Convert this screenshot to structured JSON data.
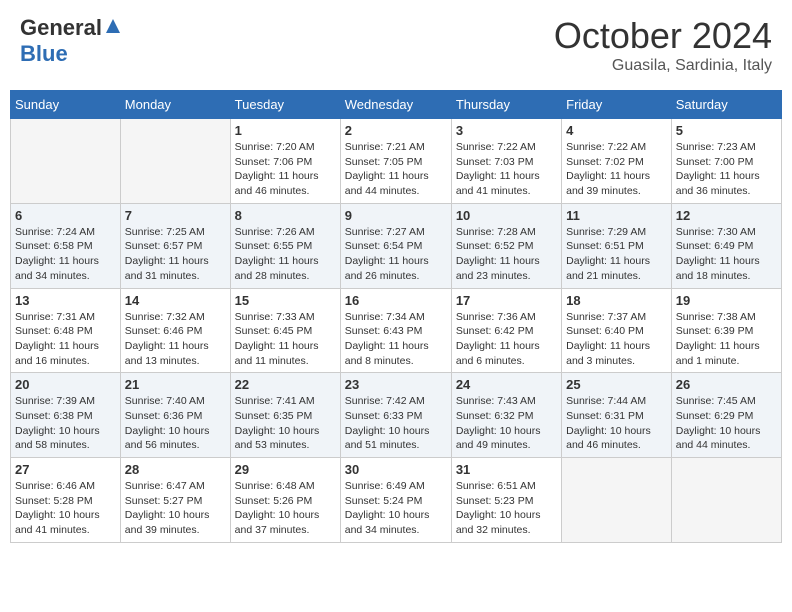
{
  "header": {
    "logo_general": "General",
    "logo_blue": "Blue",
    "month_title": "October 2024",
    "location": "Guasila, Sardinia, Italy"
  },
  "days_of_week": [
    "Sunday",
    "Monday",
    "Tuesday",
    "Wednesday",
    "Thursday",
    "Friday",
    "Saturday"
  ],
  "weeks": [
    [
      {
        "day": "",
        "empty": true
      },
      {
        "day": "",
        "empty": true
      },
      {
        "day": "1",
        "sunrise": "7:20 AM",
        "sunset": "7:06 PM",
        "daylight": "11 hours and 46 minutes."
      },
      {
        "day": "2",
        "sunrise": "7:21 AM",
        "sunset": "7:05 PM",
        "daylight": "11 hours and 44 minutes."
      },
      {
        "day": "3",
        "sunrise": "7:22 AM",
        "sunset": "7:03 PM",
        "daylight": "11 hours and 41 minutes."
      },
      {
        "day": "4",
        "sunrise": "7:22 AM",
        "sunset": "7:02 PM",
        "daylight": "11 hours and 39 minutes."
      },
      {
        "day": "5",
        "sunrise": "7:23 AM",
        "sunset": "7:00 PM",
        "daylight": "11 hours and 36 minutes."
      }
    ],
    [
      {
        "day": "6",
        "sunrise": "7:24 AM",
        "sunset": "6:58 PM",
        "daylight": "11 hours and 34 minutes."
      },
      {
        "day": "7",
        "sunrise": "7:25 AM",
        "sunset": "6:57 PM",
        "daylight": "11 hours and 31 minutes."
      },
      {
        "day": "8",
        "sunrise": "7:26 AM",
        "sunset": "6:55 PM",
        "daylight": "11 hours and 28 minutes."
      },
      {
        "day": "9",
        "sunrise": "7:27 AM",
        "sunset": "6:54 PM",
        "daylight": "11 hours and 26 minutes."
      },
      {
        "day": "10",
        "sunrise": "7:28 AM",
        "sunset": "6:52 PM",
        "daylight": "11 hours and 23 minutes."
      },
      {
        "day": "11",
        "sunrise": "7:29 AM",
        "sunset": "6:51 PM",
        "daylight": "11 hours and 21 minutes."
      },
      {
        "day": "12",
        "sunrise": "7:30 AM",
        "sunset": "6:49 PM",
        "daylight": "11 hours and 18 minutes."
      }
    ],
    [
      {
        "day": "13",
        "sunrise": "7:31 AM",
        "sunset": "6:48 PM",
        "daylight": "11 hours and 16 minutes."
      },
      {
        "day": "14",
        "sunrise": "7:32 AM",
        "sunset": "6:46 PM",
        "daylight": "11 hours and 13 minutes."
      },
      {
        "day": "15",
        "sunrise": "7:33 AM",
        "sunset": "6:45 PM",
        "daylight": "11 hours and 11 minutes."
      },
      {
        "day": "16",
        "sunrise": "7:34 AM",
        "sunset": "6:43 PM",
        "daylight": "11 hours and 8 minutes."
      },
      {
        "day": "17",
        "sunrise": "7:36 AM",
        "sunset": "6:42 PM",
        "daylight": "11 hours and 6 minutes."
      },
      {
        "day": "18",
        "sunrise": "7:37 AM",
        "sunset": "6:40 PM",
        "daylight": "11 hours and 3 minutes."
      },
      {
        "day": "19",
        "sunrise": "7:38 AM",
        "sunset": "6:39 PM",
        "daylight": "11 hours and 1 minute."
      }
    ],
    [
      {
        "day": "20",
        "sunrise": "7:39 AM",
        "sunset": "6:38 PM",
        "daylight": "10 hours and 58 minutes."
      },
      {
        "day": "21",
        "sunrise": "7:40 AM",
        "sunset": "6:36 PM",
        "daylight": "10 hours and 56 minutes."
      },
      {
        "day": "22",
        "sunrise": "7:41 AM",
        "sunset": "6:35 PM",
        "daylight": "10 hours and 53 minutes."
      },
      {
        "day": "23",
        "sunrise": "7:42 AM",
        "sunset": "6:33 PM",
        "daylight": "10 hours and 51 minutes."
      },
      {
        "day": "24",
        "sunrise": "7:43 AM",
        "sunset": "6:32 PM",
        "daylight": "10 hours and 49 minutes."
      },
      {
        "day": "25",
        "sunrise": "7:44 AM",
        "sunset": "6:31 PM",
        "daylight": "10 hours and 46 minutes."
      },
      {
        "day": "26",
        "sunrise": "7:45 AM",
        "sunset": "6:29 PM",
        "daylight": "10 hours and 44 minutes."
      }
    ],
    [
      {
        "day": "27",
        "sunrise": "6:46 AM",
        "sunset": "5:28 PM",
        "daylight": "10 hours and 41 minutes."
      },
      {
        "day": "28",
        "sunrise": "6:47 AM",
        "sunset": "5:27 PM",
        "daylight": "10 hours and 39 minutes."
      },
      {
        "day": "29",
        "sunrise": "6:48 AM",
        "sunset": "5:26 PM",
        "daylight": "10 hours and 37 minutes."
      },
      {
        "day": "30",
        "sunrise": "6:49 AM",
        "sunset": "5:24 PM",
        "daylight": "10 hours and 34 minutes."
      },
      {
        "day": "31",
        "sunrise": "6:51 AM",
        "sunset": "5:23 PM",
        "daylight": "10 hours and 32 minutes."
      },
      {
        "day": "",
        "empty": true
      },
      {
        "day": "",
        "empty": true
      }
    ]
  ],
  "labels": {
    "sunrise": "Sunrise:",
    "sunset": "Sunset:",
    "daylight": "Daylight:"
  }
}
